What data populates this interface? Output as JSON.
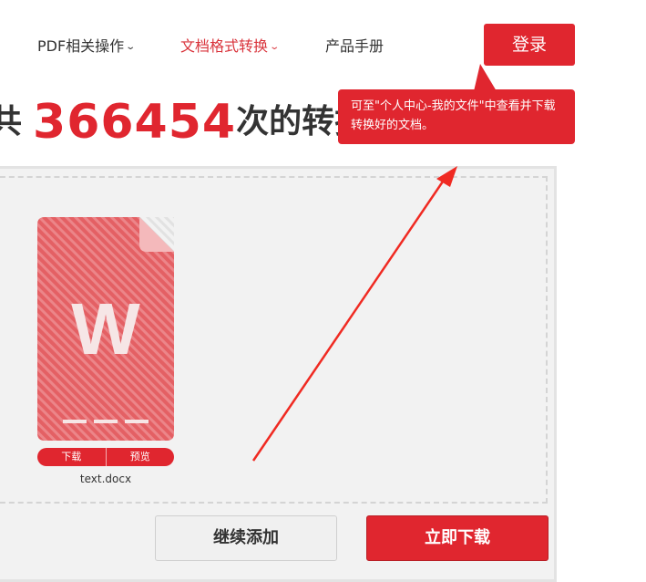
{
  "nav": {
    "pdf_ops": "PDF相关操作",
    "format_convert": "文档格式转换",
    "manual": "产品手册",
    "login": "登录"
  },
  "headline": {
    "prefix": "共",
    "count": "366454",
    "suffix": "次的转换"
  },
  "tooltip": {
    "text": "可至\"个人中心-我的文件\"中查看并下载转换好的文档。"
  },
  "file": {
    "icon_letter": "W",
    "download_label": "下载",
    "preview_label": "预览",
    "name": "text.docx"
  },
  "actions": {
    "continue_label": "继续添加",
    "download_label": "立即下载"
  },
  "colors": {
    "accent": "#e0262f",
    "file_icon": "#e46064",
    "panel_bg": "#f2f2f2"
  }
}
